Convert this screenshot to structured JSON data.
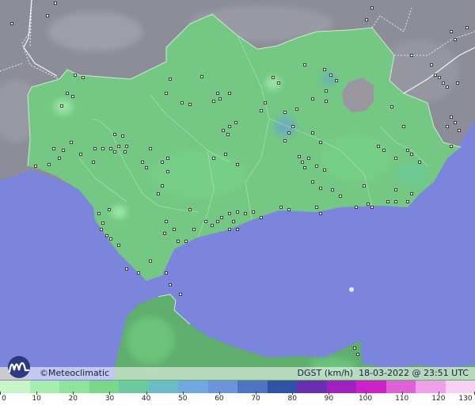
{
  "brand": {
    "name": "Meteoclimatic",
    "copyright": "©"
  },
  "info": {
    "variable": "DGST (km/h)",
    "datetime": "18-03-2022 @ 23:51 UTC"
  },
  "legend": {
    "ticks": [
      "0",
      "10",
      "20",
      "30",
      "40",
      "50",
      "60",
      "70",
      "80",
      "90",
      "100",
      "110",
      "120",
      "130"
    ],
    "colors": [
      "#c8f5c8",
      "#a8ecb0",
      "#8fe49c",
      "#79d88a",
      "#6cc9a0",
      "#6bbbc8",
      "#72a8e0",
      "#6c93dc",
      "#4f74c4",
      "#3052a8",
      "#6a2fb0",
      "#a020c0",
      "#cc20c8",
      "#e060d8",
      "#f0a0e8",
      "#f8d0f4"
    ]
  },
  "colors": {
    "sea": "#7b85db",
    "land_out": "#8d8d99",
    "region": "#74c884",
    "morocco": "#5fae6e"
  },
  "icons": {
    "logo": "meteoclimatic-logo",
    "station": "station-marker"
  }
}
